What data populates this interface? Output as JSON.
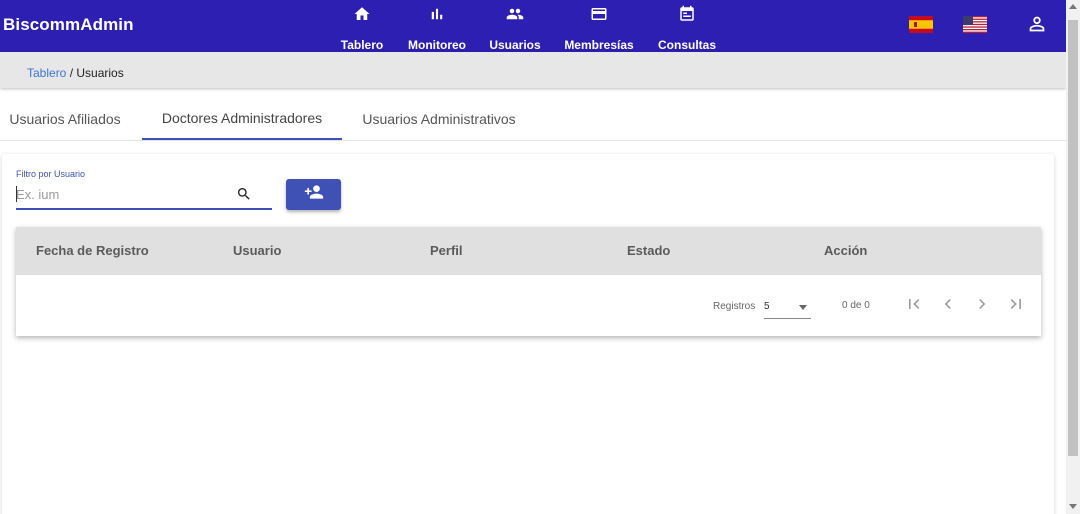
{
  "app": {
    "title": "BiscommAdmin"
  },
  "nav": {
    "items": [
      {
        "label": "Tablero",
        "icon": "home-icon"
      },
      {
        "label": "Monitoreo",
        "icon": "bar-chart-icon"
      },
      {
        "label": "Usuarios",
        "icon": "people-icon"
      },
      {
        "label": "Membresías",
        "icon": "credit-card-icon"
      },
      {
        "label": "Consultas",
        "icon": "calendar-icon"
      }
    ]
  },
  "header_right": {
    "flags": [
      "spain-flag-icon",
      "usa-flag-icon"
    ],
    "user_icon": "person-icon"
  },
  "breadcrumb": {
    "link": "Tablero",
    "separator": " / ",
    "current": "Usuarios"
  },
  "tabs": [
    {
      "label": "Usuarios Afiliados",
      "active": false
    },
    {
      "label": "Doctores Administradores",
      "active": true
    },
    {
      "label": "Usuarios Administrativos",
      "active": false
    }
  ],
  "filter": {
    "label": "Filtro por Usuario",
    "placeholder": "Ex. ium",
    "value": ""
  },
  "add_button": {
    "icon": "person-add-icon"
  },
  "table": {
    "columns": [
      "Fecha de Registro",
      "Usuario",
      "Perfil",
      "Estado",
      "Acción"
    ],
    "rows": []
  },
  "paginator": {
    "label": "Registros",
    "page_size": "5",
    "range": "0 de 0"
  },
  "colors": {
    "toolbar": "#2c1fb1",
    "accent": "#3f51b5",
    "link": "#3b74d6",
    "header_bg": "#e0e0e0"
  }
}
